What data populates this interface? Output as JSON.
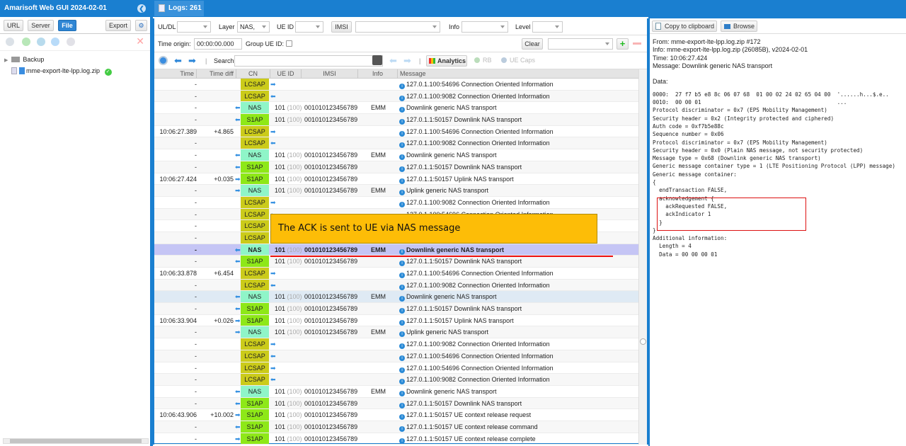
{
  "app": {
    "title": "Amarisoft Web GUI 2024-02-01"
  },
  "left_panel": {
    "buttons": {
      "url": "URL",
      "server": "Server",
      "file": "File",
      "export": "Export"
    },
    "tree": [
      {
        "label": "Backup",
        "type": "folder"
      },
      {
        "label": "mme-export-lte-lpp.log.zip",
        "type": "file",
        "status": "ok"
      }
    ]
  },
  "tab": {
    "label": "Logs: 261"
  },
  "filters": {
    "uldl_label": "UL/DL",
    "uldl_value": "",
    "layer_label": "Layer",
    "layer_value": "NAS,",
    "ueid_label": "UE ID",
    "ueid_value": "",
    "imsi_button": "IMSI",
    "imsi_value": "",
    "info_label": "Info",
    "info_value": "",
    "level_label": "Level",
    "level_value": "",
    "time_origin_label": "Time origin:",
    "time_origin_value": "00:00:00.000",
    "group_ueid_label": "Group UE ID:",
    "clear_button": "Clear",
    "search_label": "Search",
    "search_value": "",
    "analytics_button": "Analytics",
    "rb_button": "RB",
    "uecaps_button": "UE Caps"
  },
  "grid": {
    "columns": [
      "Time",
      "Time diff",
      "CN",
      "UE ID",
      "IMSI",
      "Info",
      "Message"
    ],
    "rows": [
      {
        "time": "-",
        "diff": "",
        "cn": "LCSAP",
        "dir": "right",
        "ueid": "",
        "ueid2": "",
        "imsi": "",
        "info": "",
        "msg": "127.0.1.100:54696 Connection Oriented Information"
      },
      {
        "time": "-",
        "diff": "",
        "cn": "LCSAP",
        "dir": "left",
        "ueid": "",
        "ueid2": "",
        "imsi": "",
        "info": "",
        "msg": "127.0.1.100:9082 Connection Oriented Information"
      },
      {
        "time": "-",
        "diff": "",
        "cn": "NAS",
        "dir": "left",
        "ueid": "101",
        "ueid2": "(100)",
        "imsi": "001010123456789",
        "info": "EMM",
        "msg": "Downlink generic NAS transport"
      },
      {
        "time": "-",
        "diff": "",
        "cn": "S1AP",
        "dir": "left",
        "ueid": "101",
        "ueid2": "(100)",
        "imsi": "001010123456789",
        "info": "",
        "msg": "127.0.1.1:50157 Downlink NAS transport"
      },
      {
        "time": "10:06:27.389",
        "diff": "+4.865",
        "cn": "LCSAP",
        "dir": "right",
        "ueid": "",
        "ueid2": "",
        "imsi": "",
        "info": "",
        "msg": "127.0.1.100:54696 Connection Oriented Information"
      },
      {
        "time": "-",
        "diff": "",
        "cn": "LCSAP",
        "dir": "left",
        "ueid": "",
        "ueid2": "",
        "imsi": "",
        "info": "",
        "msg": "127.0.1.100:9082 Connection Oriented Information"
      },
      {
        "time": "-",
        "diff": "",
        "cn": "NAS",
        "dir": "left",
        "ueid": "101",
        "ueid2": "(100)",
        "imsi": "001010123456789",
        "info": "EMM",
        "msg": "Downlink generic NAS transport"
      },
      {
        "time": "-",
        "diff": "",
        "cn": "S1AP",
        "dir": "left",
        "ueid": "101",
        "ueid2": "(100)",
        "imsi": "001010123456789",
        "info": "",
        "msg": "127.0.1.1:50157 Downlink NAS transport"
      },
      {
        "time": "10:06:27.424",
        "diff": "+0.035",
        "cn": "S1AP",
        "dir": "right",
        "ueid": "101",
        "ueid2": "(100)",
        "imsi": "001010123456789",
        "info": "",
        "msg": "127.0.1.1:50157 Uplink NAS transport"
      },
      {
        "time": "-",
        "diff": "",
        "cn": "NAS",
        "dir": "right",
        "ueid": "101",
        "ueid2": "(100)",
        "imsi": "001010123456789",
        "info": "EMM",
        "msg": "Uplink generic NAS transport"
      },
      {
        "time": "-",
        "diff": "",
        "cn": "LCSAP",
        "dir": "right",
        "ueid": "",
        "ueid2": "",
        "imsi": "",
        "info": "",
        "msg": "127.0.1.100:9082 Connection Oriented Information"
      },
      {
        "time": "-",
        "diff": "",
        "cn": "LCSAP",
        "dir": "left",
        "ueid": "",
        "ueid2": "",
        "imsi": "",
        "info": "",
        "msg": "127.0.1.100:54696 Connection Oriented Information"
      },
      {
        "time": "-",
        "diff": "",
        "cn": "LCSAP",
        "dir": "left",
        "ueid": "",
        "ueid2": "",
        "imsi": "",
        "info": "",
        "msg": ""
      },
      {
        "time": "-",
        "diff": "",
        "cn": "LCSAP",
        "dir": "left",
        "ueid": "",
        "ueid2": "",
        "imsi": "",
        "info": "",
        "msg": ""
      },
      {
        "time": "-",
        "diff": "",
        "cn": "NAS",
        "dir": "left",
        "ueid": "101",
        "ueid2": "(100)",
        "imsi": "001010123456789",
        "info": "EMM",
        "msg": "Downlink generic NAS transport",
        "selected": true
      },
      {
        "time": "-",
        "diff": "",
        "cn": "S1AP",
        "dir": "left",
        "ueid": "101",
        "ueid2": "(100)",
        "imsi": "001010123456789",
        "info": "",
        "msg": "127.0.1.1:50157 Downlink NAS transport"
      },
      {
        "time": "10:06:33.878",
        "diff": "+6.454",
        "cn": "LCSAP",
        "dir": "right",
        "ueid": "",
        "ueid2": "",
        "imsi": "",
        "info": "",
        "msg": "127.0.1.100:54696 Connection Oriented Information"
      },
      {
        "time": "-",
        "diff": "",
        "cn": "LCSAP",
        "dir": "left",
        "ueid": "",
        "ueid2": "",
        "imsi": "",
        "info": "",
        "msg": "127.0.1.100:9082 Connection Oriented Information"
      },
      {
        "time": "-",
        "diff": "",
        "cn": "NAS",
        "dir": "left",
        "ueid": "101",
        "ueid2": "(100)",
        "imsi": "001010123456789",
        "info": "EMM",
        "msg": "Downlink generic NAS transport",
        "hover": true
      },
      {
        "time": "-",
        "diff": "",
        "cn": "S1AP",
        "dir": "left",
        "ueid": "101",
        "ueid2": "(100)",
        "imsi": "001010123456789",
        "info": "",
        "msg": "127.0.1.1:50157 Downlink NAS transport"
      },
      {
        "time": "10:06:33.904",
        "diff": "+0.026",
        "cn": "S1AP",
        "dir": "right",
        "ueid": "101",
        "ueid2": "(100)",
        "imsi": "001010123456789",
        "info": "",
        "msg": "127.0.1.1:50157 Uplink NAS transport"
      },
      {
        "time": "-",
        "diff": "",
        "cn": "NAS",
        "dir": "right",
        "ueid": "101",
        "ueid2": "(100)",
        "imsi": "001010123456789",
        "info": "EMM",
        "msg": "Uplink generic NAS transport"
      },
      {
        "time": "-",
        "diff": "",
        "cn": "LCSAP",
        "dir": "right",
        "ueid": "",
        "ueid2": "",
        "imsi": "",
        "info": "",
        "msg": "127.0.1.100:9082 Connection Oriented Information"
      },
      {
        "time": "-",
        "diff": "",
        "cn": "LCSAP",
        "dir": "left",
        "ueid": "",
        "ueid2": "",
        "imsi": "",
        "info": "",
        "msg": "127.0.1.100:54696 Connection Oriented Information"
      },
      {
        "time": "-",
        "diff": "",
        "cn": "LCSAP",
        "dir": "right",
        "ueid": "",
        "ueid2": "",
        "imsi": "",
        "info": "",
        "msg": "127.0.1.100:54696 Connection Oriented Information"
      },
      {
        "time": "-",
        "diff": "",
        "cn": "LCSAP",
        "dir": "left",
        "ueid": "",
        "ueid2": "",
        "imsi": "",
        "info": "",
        "msg": "127.0.1.100:9082 Connection Oriented Information"
      },
      {
        "time": "-",
        "diff": "",
        "cn": "NAS",
        "dir": "left",
        "ueid": "101",
        "ueid2": "(100)",
        "imsi": "001010123456789",
        "info": "EMM",
        "msg": "Downlink generic NAS transport"
      },
      {
        "time": "-",
        "diff": "",
        "cn": "S1AP",
        "dir": "left",
        "ueid": "101",
        "ueid2": "(100)",
        "imsi": "001010123456789",
        "info": "",
        "msg": "127.0.1.1:50157 Downlink NAS transport"
      },
      {
        "time": "10:06:43.906",
        "diff": "+10.002",
        "cn": "S1AP",
        "dir": "right",
        "ueid": "101",
        "ueid2": "(100)",
        "imsi": "001010123456789",
        "info": "",
        "msg": "127.0.1.1:50157 UE context release request"
      },
      {
        "time": "-",
        "diff": "",
        "cn": "S1AP",
        "dir": "left",
        "ueid": "101",
        "ueid2": "(100)",
        "imsi": "001010123456789",
        "info": "",
        "msg": "127.0.1.1:50157 UE context release command"
      },
      {
        "time": "-",
        "diff": "",
        "cn": "S1AP",
        "dir": "right",
        "ueid": "101",
        "ueid2": "(100)",
        "imsi": "001010123456789",
        "info": "",
        "msg": "127.0.1.1:50157 UE context release complete"
      }
    ]
  },
  "annotation": {
    "callout": "The ACK is sent to UE via NAS message"
  },
  "detail": {
    "copy_button": "Copy to clipboard",
    "browse_button": "Browse",
    "header_lines": [
      "From: mme-export-lte-lpp.log.zip #172",
      "Info: mme-export-lte-lpp.log.zip (26085B), v2024-02-01",
      "Time: 10:06:27.424",
      "Message: Downlink generic NAS transport",
      "",
      "Data:"
    ],
    "hex_lines": [
      "0000:  27 f7 b5 e8 8c 06 07 68  01 00 02 24 02 65 04 00  '......h...$.e..",
      "0010:  00 00 01                                          ..."
    ],
    "decode_lines": [
      "Protocol discriminator = 0x7 (EPS Mobility Management)",
      "Security header = 0x2 (Integrity protected and ciphered)",
      "Auth code = 0xf7b5e88c",
      "Sequence number = 0x06",
      "Protocol discriminator = 0x7 (EPS Mobility Management)",
      "Security header = 0x0 (Plain NAS message, not security protected)",
      "Message type = 0x68 (Downlink generic NAS transport)",
      "Generic message container type = 1 (LTE Positioning Protocol (LPP) message)",
      "Generic message container:",
      "{",
      "  endTransaction FALSE,",
      "  acknowledgement {",
      "    ackRequested FALSE,",
      "    ackIndicator 1",
      "  }",
      "}",
      "Additional information:",
      "  Length = 4",
      "  Data = 00 00 00 01"
    ]
  }
}
